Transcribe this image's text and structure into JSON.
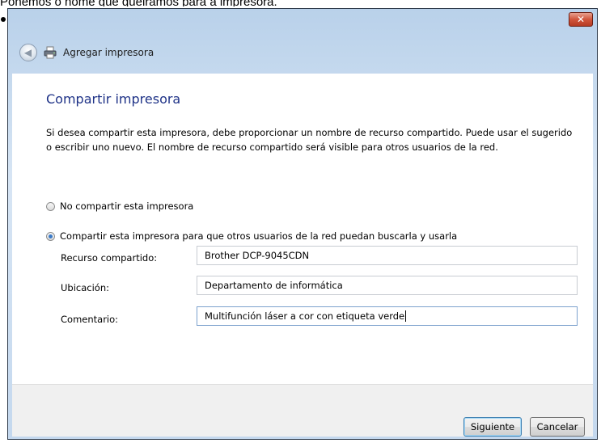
{
  "caption": "Ponemos o nome que queiramos para a impresora.",
  "window": {
    "close_label": "✕",
    "back_icon": "back-arrow-icon",
    "title": "Agregar impresora",
    "title_icon": "printer-icon"
  },
  "page": {
    "heading": "Compartir impresora",
    "description": "Si desea compartir esta impresora, debe proporcionar un nombre de recurso compartido. Puede usar el sugerido o escribir uno nuevo. El nombre de recurso compartido será visible para otros usuarios de la red.",
    "options": [
      {
        "label": "No compartir esta impresora",
        "selected": false
      },
      {
        "label": "Compartir esta impresora para que otros usuarios de la red puedan buscarla y usarla",
        "selected": true
      }
    ],
    "fields": {
      "share_name": {
        "label": "Recurso compartido:",
        "value": "Brother DCP-9045CDN"
      },
      "location": {
        "label": "Ubicación:",
        "value": "Departamento de informática"
      },
      "comment": {
        "label": "Comentario:",
        "value": "Multifunción láser a cor con etiqueta verde"
      }
    }
  },
  "buttons": {
    "next": "Siguiente",
    "cancel": "Cancelar"
  },
  "colors": {
    "heading": "#1e3287",
    "titlebar": "#b9d1ea",
    "close": "#c9472f"
  }
}
